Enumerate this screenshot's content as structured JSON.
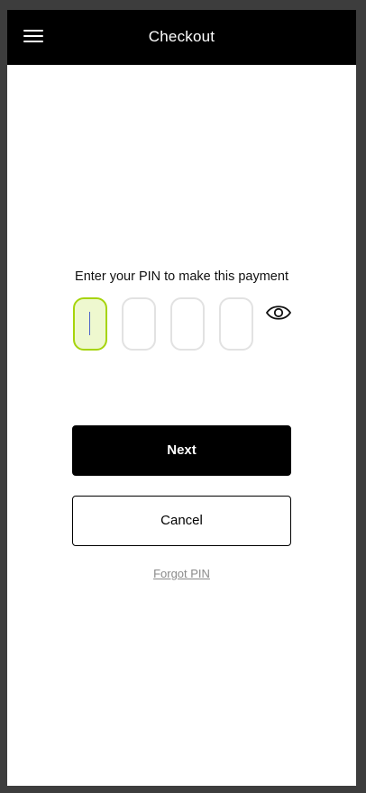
{
  "header": {
    "title": "Checkout",
    "menu_icon": "hamburger-menu-icon"
  },
  "pin": {
    "label": "Enter your PIN to make this payment",
    "digits": [
      "",
      "",
      "",
      ""
    ],
    "active_index": 0,
    "toggle_icon": "eye-icon",
    "active_color": "#a6d40c"
  },
  "actions": {
    "next_label": "Next",
    "cancel_label": "Cancel",
    "forgot_label": "Forgot PIN"
  }
}
